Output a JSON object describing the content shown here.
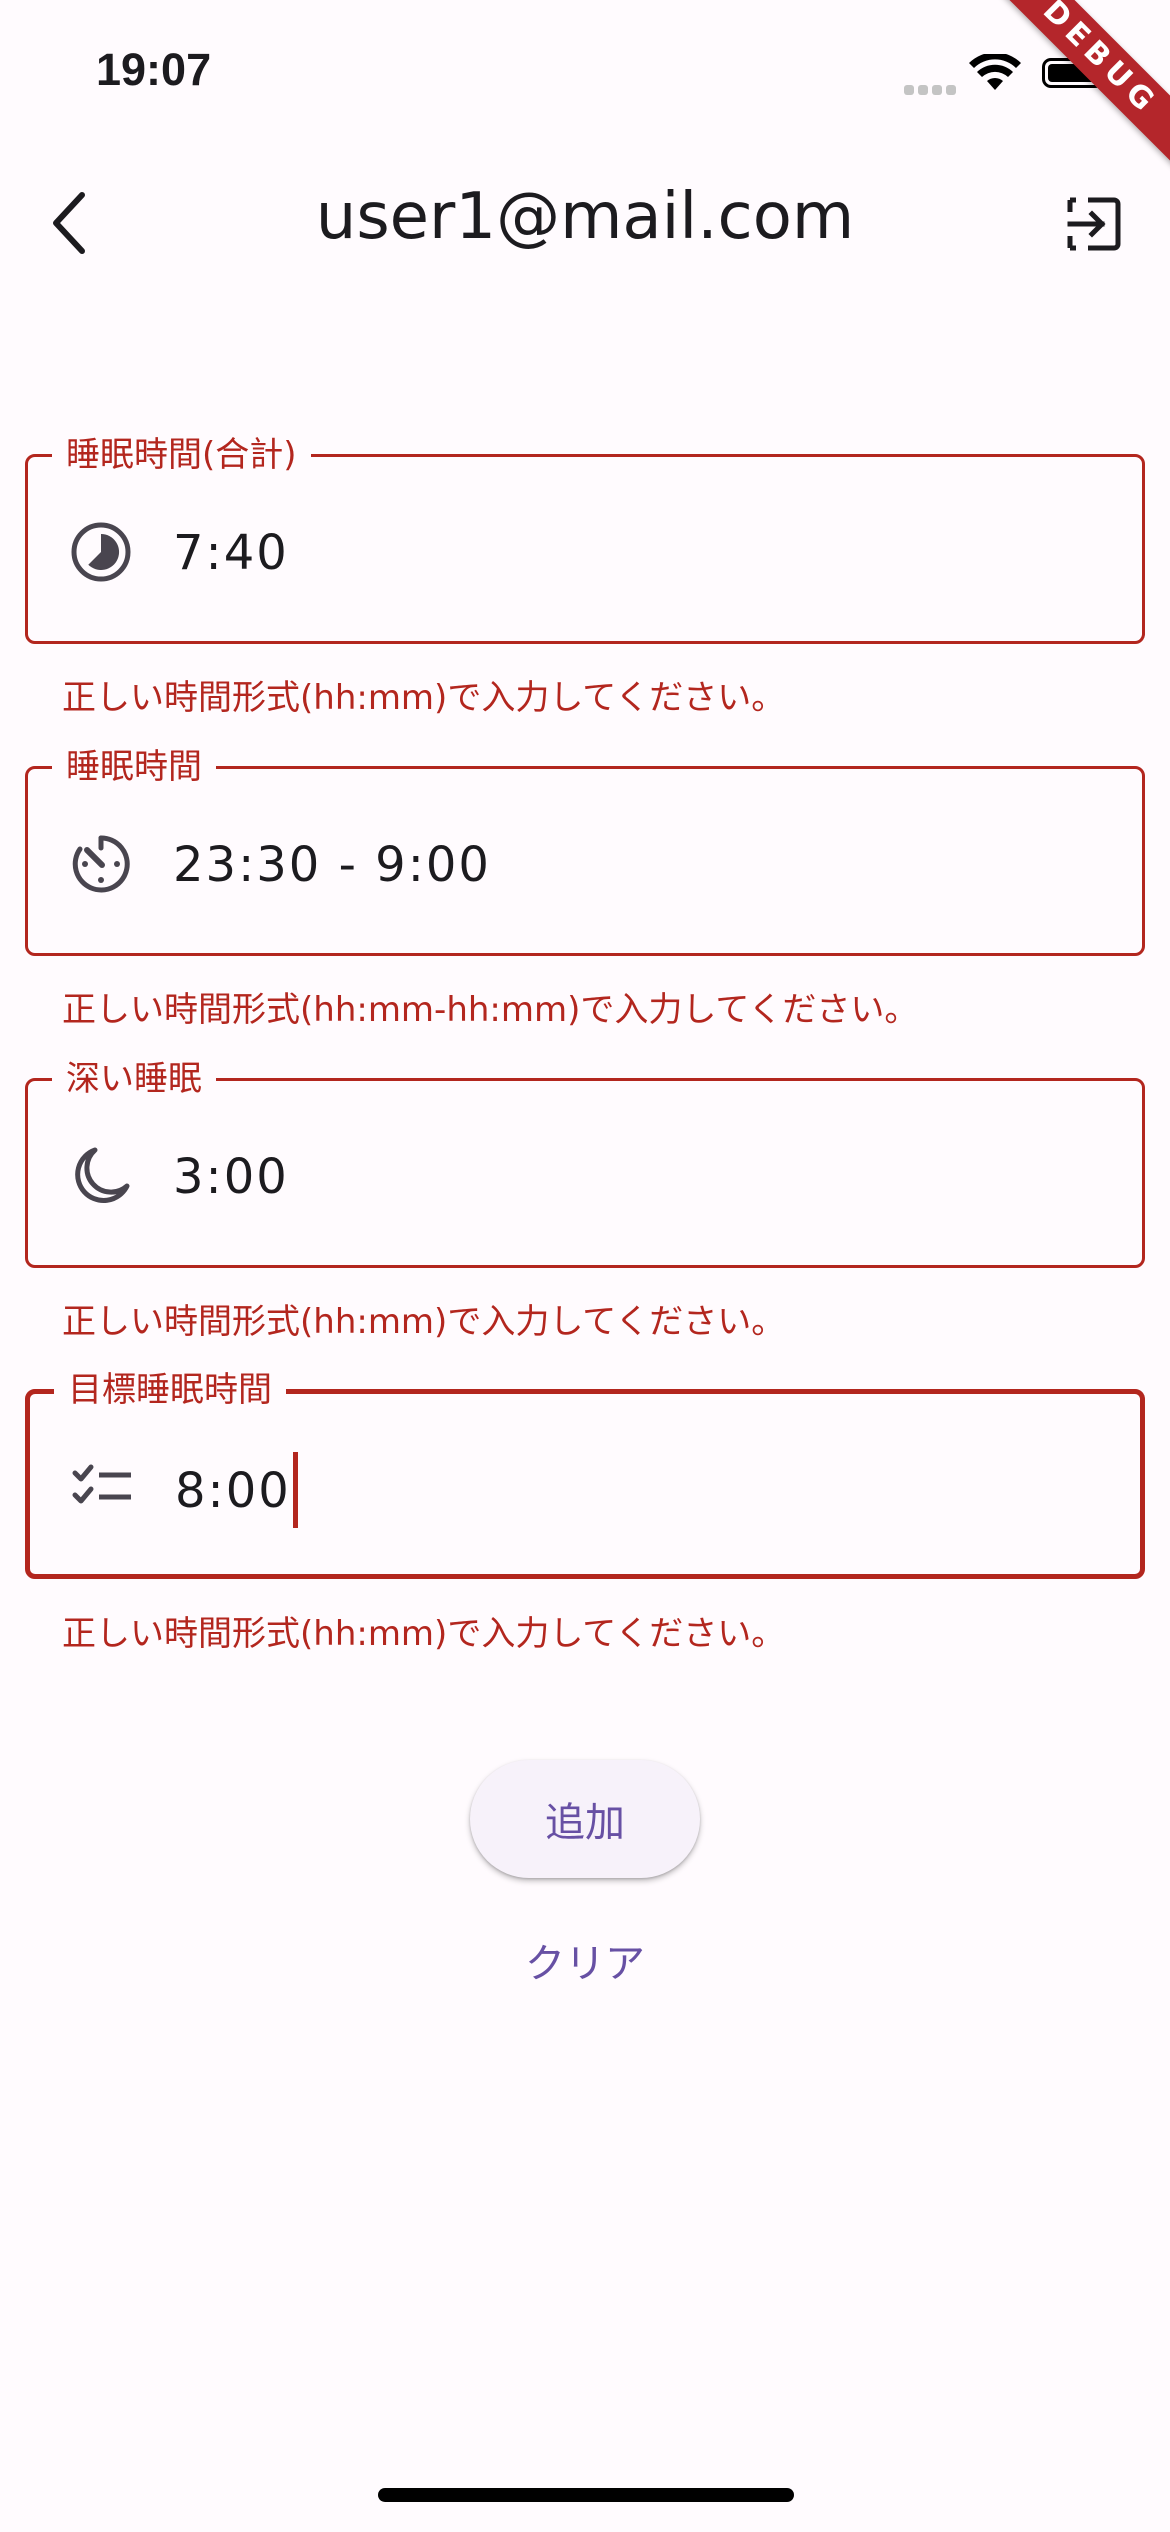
{
  "status_bar": {
    "time": "19:07"
  },
  "debug_banner": "DEBUG",
  "app_bar": {
    "title": "user1@mail.com",
    "back_icon": "chevron-left-icon",
    "logout_icon": "logout-icon"
  },
  "fields": [
    {
      "label": "睡眠時間(合計)",
      "value": "7:40",
      "icon": "clock-icon",
      "error": "正しい時間形式(hh:mm)で入力してください。"
    },
    {
      "label": "睡眠時間",
      "value": "23:30 - 9:00",
      "icon": "timer-icon",
      "error": "正しい時間形式(hh:mm-hh:mm)で入力してください。"
    },
    {
      "label": "深い睡眠",
      "value": "3:00",
      "icon": "moon-icon",
      "error": "正しい時間形式(hh:mm)で入力してください。"
    },
    {
      "label": "目標睡眠時間",
      "value": "8:00",
      "icon": "checklist-icon",
      "error": "正しい時間形式(hh:mm)で入力してください。"
    }
  ],
  "buttons": {
    "add": "追加",
    "clear": "クリア"
  },
  "colors": {
    "error": "#b3261e",
    "primary": "#6750a4",
    "background": "#fffbfe"
  }
}
